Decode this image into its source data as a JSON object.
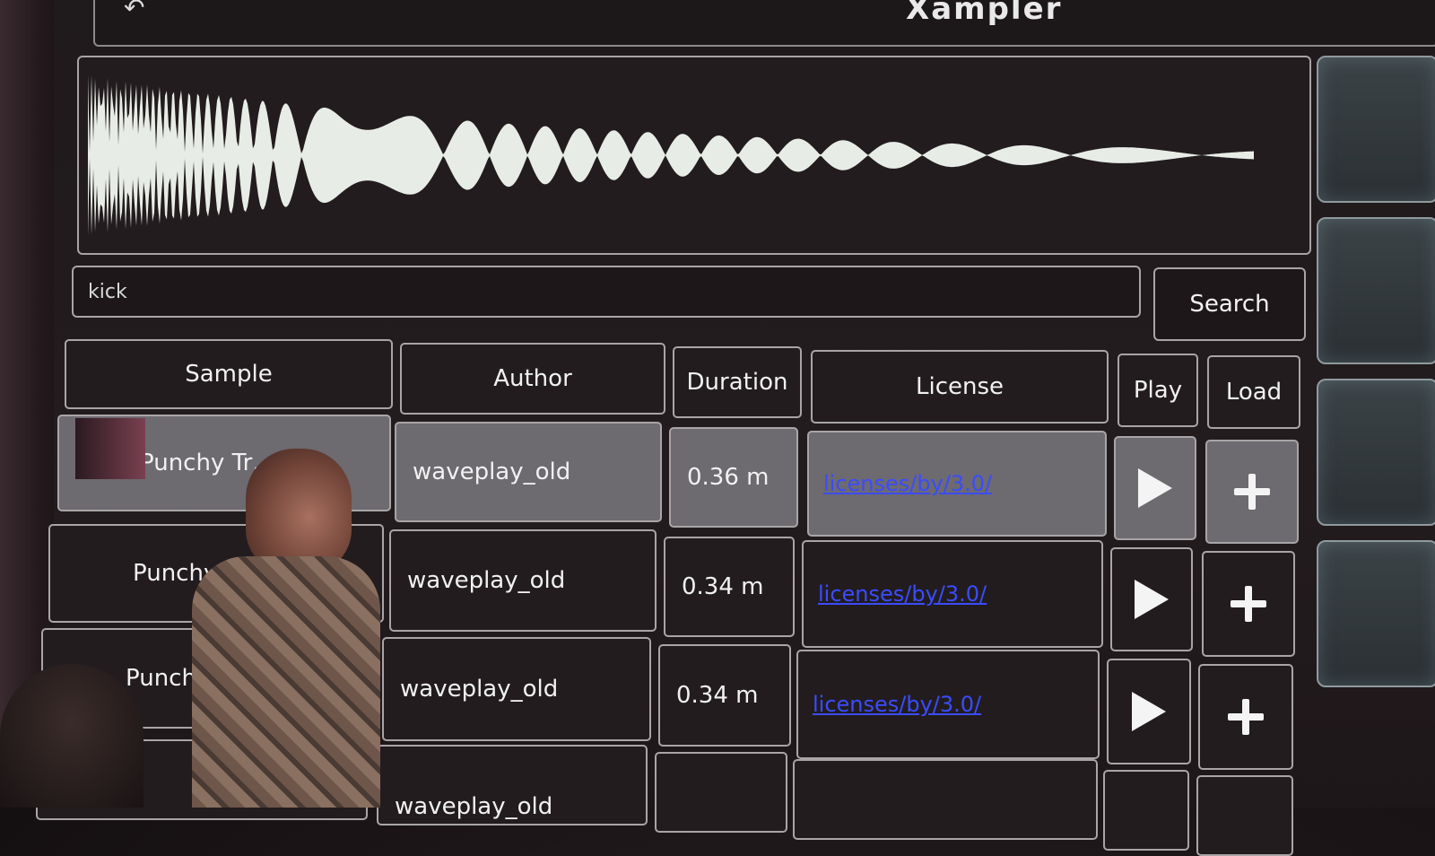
{
  "app": {
    "title": "Xampler"
  },
  "search": {
    "value": "kick",
    "button_label": "Search"
  },
  "table": {
    "headers": {
      "sample": "Sample",
      "author": "Author",
      "duration": "Duration",
      "license": "License",
      "play": "Play",
      "load": "Load"
    },
    "rows": [
      {
        "sample": "Punchy Tr…k 4",
        "author": "waveplay_old",
        "duration": "0.36 m",
        "license": "licenses/by/3.0/",
        "selected": true
      },
      {
        "sample": "Punchy",
        "author": "waveplay_old",
        "duration": "0.34 m",
        "license": "licenses/by/3.0/",
        "selected": false
      },
      {
        "sample": "Punchy",
        "author": "waveplay_old",
        "duration": "0.34 m",
        "license": "licenses/by/3.0/",
        "selected": false
      },
      {
        "sample": "",
        "author": "waveplay_old",
        "duration": "",
        "license": "",
        "selected": false
      }
    ]
  },
  "icons": {
    "back": "back-icon",
    "play": "play-icon",
    "load": "plus-icon"
  },
  "colors": {
    "link": "#3a4cff",
    "selected_row": "#6d6a70",
    "border": "#a9a5a7"
  }
}
